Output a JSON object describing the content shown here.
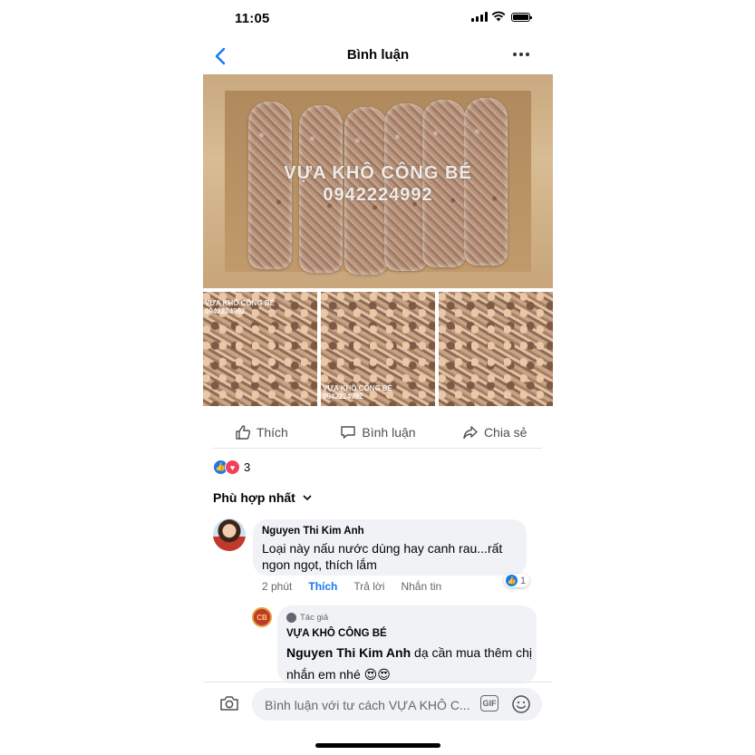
{
  "status_bar": {
    "time": "11:05"
  },
  "nav": {
    "title": "Bình luận",
    "back_icon": "chevron-left-icon",
    "more_icon": "more-horizontal-icon"
  },
  "post": {
    "watermark_line1": "VỰA KHÔ CÔNG BÉ",
    "watermark_line2": "0942224992",
    "thumb_watermark1": "VỰA KHÔ CÔNG BÉ",
    "thumb_watermark2": "0942224992"
  },
  "actions": {
    "like": "Thích",
    "comment": "Bình luận",
    "share": "Chia sẻ"
  },
  "reactions": {
    "count": "3"
  },
  "sort": {
    "label": "Phù hợp nhất"
  },
  "comments": [
    {
      "name": "Nguyen Thi Kim Anh",
      "text": "Loại này nấu nước dùng hay canh rau...rất ngon ngọt, thích lắm",
      "time": "2 phút",
      "like": "Thích",
      "reply": "Trả lời",
      "message": "Nhắn tin",
      "reaction_count": "1"
    }
  ],
  "reply": {
    "tag": "Tác giả",
    "name": "VỰA KHÔ CÔNG BÉ",
    "mention": "Nguyen Thi Kim Anh",
    "text": " dạ cần mua thêm chị nhắn em nhé 😍😍",
    "avatar_text": "CB"
  },
  "composer": {
    "placeholder": "Bình luận với tư cách VỰA KHÔ C...",
    "gif": "GIF"
  },
  "colors": {
    "accent": "#1877f2",
    "love": "#f33e58",
    "bubble": "#f0f2f5"
  }
}
